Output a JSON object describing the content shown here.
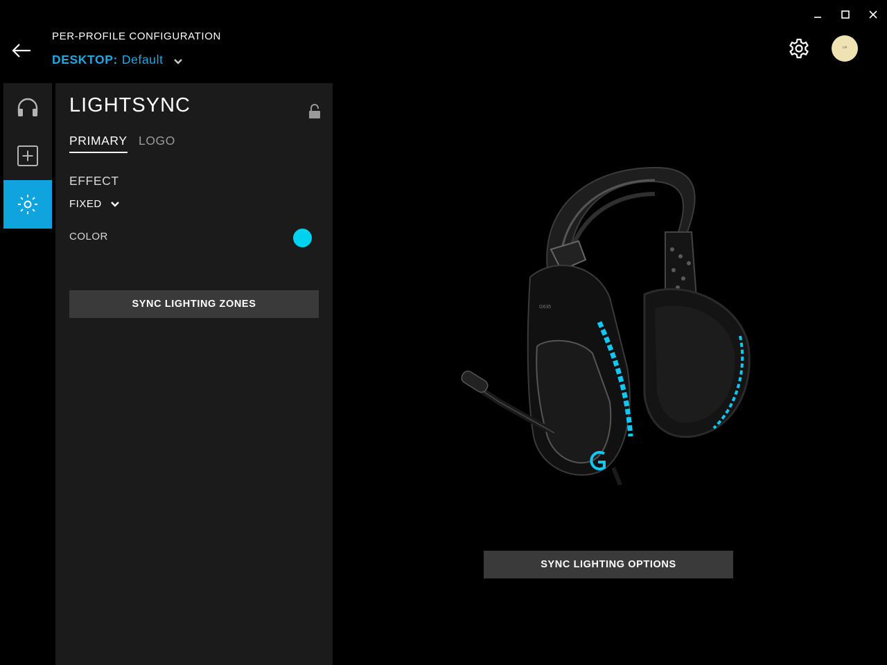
{
  "window_controls": {
    "minimize_icon": "minimize-icon",
    "maximize_icon": "maximize-icon",
    "close_icon": "close-icon"
  },
  "header": {
    "back_icon": "arrow-left-icon",
    "title": "PER-PROFILE CONFIGURATION",
    "profile": {
      "prefix": "DESKTOP:",
      "name": "Default"
    },
    "settings_icon": "gear-icon",
    "avatar_text": "ᴸᴬᴵ"
  },
  "rail": {
    "items": [
      {
        "icon": "headphones-icon",
        "active": false
      },
      {
        "icon": "plus-square-icon",
        "active": false
      },
      {
        "icon": "lighting-icon",
        "active": true
      }
    ]
  },
  "lightsync": {
    "title": "LIGHTSYNC",
    "lock_icon": "unlock-icon",
    "tabs": [
      {
        "label": "PRIMARY",
        "active": true
      },
      {
        "label": "LOGO",
        "active": false
      }
    ],
    "effect_label": "EFFECT",
    "effect_value": "FIXED",
    "color_label": "COLOR",
    "color_value": "#00d2f0",
    "sync_zones_button": "SYNC LIGHTING ZONES"
  },
  "device": {
    "model_text": "G635",
    "sync_options_button": "SYNC LIGHTING OPTIONS"
  },
  "colors": {
    "accent": "#21a8e0",
    "rail_active": "#0fa4dd",
    "panel_bg": "#1b1b1b",
    "button_bg": "#3a3a3a",
    "led": "#10c8f4"
  }
}
